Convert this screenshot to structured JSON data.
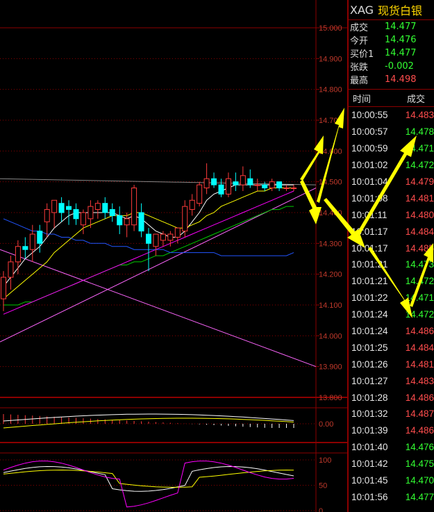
{
  "header": {
    "symbol": "XAG",
    "name": "现货白银"
  },
  "quote": [
    {
      "label": "成交",
      "value": "14.477",
      "color": "up"
    },
    {
      "label": "今开",
      "value": "14.476",
      "color": "up"
    },
    {
      "label": "买价1",
      "value": "14.477",
      "color": "up"
    },
    {
      "label": "张跌",
      "value": "-0.002",
      "color": "up"
    },
    {
      "label": "最高",
      "value": "14.498",
      "color": "dn"
    }
  ],
  "table": {
    "col_time": "时间",
    "col_price": "成交",
    "rows": [
      {
        "time": "10:00:55",
        "price": "14.483",
        "dir": "dn"
      },
      {
        "time": "10:00:57",
        "price": "14.478",
        "dir": "up"
      },
      {
        "time": "10:00:59",
        "price": "14.471",
        "dir": "up"
      },
      {
        "time": "10:01:02",
        "price": "14.472",
        "dir": "up"
      },
      {
        "time": "10:01:04",
        "price": "14.479",
        "dir": "dn"
      },
      {
        "time": "10:01:08",
        "price": "14.481",
        "dir": "dn"
      },
      {
        "time": "10:01:11",
        "price": "14.480",
        "dir": "dn"
      },
      {
        "time": "10:01:17",
        "price": "14.484",
        "dir": "dn"
      },
      {
        "time": "10:01:17",
        "price": "14.485",
        "dir": "dn"
      },
      {
        "time": "10:01:21",
        "price": "14.473",
        "dir": "up"
      },
      {
        "time": "10:01:21",
        "price": "14.472",
        "dir": "up"
      },
      {
        "time": "10:01:22",
        "price": "14.471",
        "dir": "up"
      },
      {
        "time": "10:01:24",
        "price": "14.472",
        "dir": "up"
      },
      {
        "time": "10:01:24",
        "price": "14.486",
        "dir": "dn"
      },
      {
        "time": "10:01:25",
        "price": "14.484",
        "dir": "dn"
      },
      {
        "time": "10:01:26",
        "price": "14.481",
        "dir": "dn"
      },
      {
        "time": "10:01:27",
        "price": "14.483",
        "dir": "dn"
      },
      {
        "time": "10:01:28",
        "price": "14.486",
        "dir": "dn"
      },
      {
        "time": "10:01:32",
        "price": "14.487",
        "dir": "dn"
      },
      {
        "time": "10:01:39",
        "price": "14.486",
        "dir": "dn"
      },
      {
        "time": "10:01:40",
        "price": "14.476",
        "dir": "up"
      },
      {
        "time": "10:01:42",
        "price": "14.475",
        "dir": "up"
      },
      {
        "time": "10:01:45",
        "price": "14.470",
        "dir": "up"
      },
      {
        "time": "10:01:56",
        "price": "14.477",
        "dir": "up"
      }
    ]
  },
  "chart_data": {
    "type": "candlestick",
    "title": "",
    "y_ticks": [
      "15.000",
      "14.900",
      "14.800",
      "14.700",
      "14.600",
      "14.500",
      "14.400",
      "14.300",
      "14.200",
      "14.100",
      "14.000",
      "13.900",
      "13.800"
    ],
    "ylim": [
      13.8,
      15.0
    ],
    "macd_ticks": [
      "0.00"
    ],
    "kdj_ticks": [
      "100",
      "50",
      "0"
    ],
    "colors": {
      "up": "#ff3b3b",
      "down": "#00ffff",
      "grid": "#8b0000",
      "arrow": "#ffff00"
    },
    "candles": [
      {
        "o": 14.12,
        "h": 14.21,
        "l": 14.08,
        "c": 14.19
      },
      {
        "o": 14.19,
        "h": 14.26,
        "l": 14.15,
        "c": 14.24
      },
      {
        "o": 14.24,
        "h": 14.31,
        "l": 14.2,
        "c": 14.29
      },
      {
        "o": 14.29,
        "h": 14.32,
        "l": 14.25,
        "c": 14.28
      },
      {
        "o": 14.28,
        "h": 14.36,
        "l": 14.24,
        "c": 14.33
      },
      {
        "o": 14.34,
        "h": 14.36,
        "l": 14.27,
        "c": 14.3
      },
      {
        "o": 14.37,
        "h": 14.43,
        "l": 14.32,
        "c": 14.41
      },
      {
        "o": 14.4,
        "h": 14.44,
        "l": 14.35,
        "c": 14.44
      },
      {
        "o": 14.43,
        "h": 14.45,
        "l": 14.37,
        "c": 14.4
      },
      {
        "o": 14.42,
        "h": 14.44,
        "l": 14.36,
        "c": 14.41
      },
      {
        "o": 14.41,
        "h": 14.43,
        "l": 14.36,
        "c": 14.38
      },
      {
        "o": 14.36,
        "h": 14.41,
        "l": 14.33,
        "c": 14.4
      },
      {
        "o": 14.38,
        "h": 14.44,
        "l": 14.35,
        "c": 14.42
      },
      {
        "o": 14.41,
        "h": 14.44,
        "l": 14.38,
        "c": 14.43
      },
      {
        "o": 14.43,
        "h": 14.45,
        "l": 14.38,
        "c": 14.4
      },
      {
        "o": 14.41,
        "h": 14.43,
        "l": 14.37,
        "c": 14.39
      },
      {
        "o": 14.39,
        "h": 14.42,
        "l": 14.33,
        "c": 14.36
      },
      {
        "o": 14.36,
        "h": 14.4,
        "l": 14.32,
        "c": 14.38
      },
      {
        "o": 14.36,
        "h": 14.49,
        "l": 14.34,
        "c": 14.48
      },
      {
        "o": 14.4,
        "h": 14.43,
        "l": 14.32,
        "c": 14.34
      },
      {
        "o": 14.33,
        "h": 14.35,
        "l": 14.21,
        "c": 14.3
      },
      {
        "o": 14.29,
        "h": 14.33,
        "l": 14.26,
        "c": 14.33
      },
      {
        "o": 14.31,
        "h": 14.34,
        "l": 14.29,
        "c": 14.33
      },
      {
        "o": 14.31,
        "h": 14.34,
        "l": 14.29,
        "c": 14.33
      },
      {
        "o": 14.32,
        "h": 14.35,
        "l": 14.3,
        "c": 14.35
      },
      {
        "o": 14.34,
        "h": 14.44,
        "l": 14.32,
        "c": 14.42
      },
      {
        "o": 14.41,
        "h": 14.46,
        "l": 14.39,
        "c": 14.44
      },
      {
        "o": 14.43,
        "h": 14.5,
        "l": 14.42,
        "c": 14.49
      },
      {
        "o": 14.48,
        "h": 14.56,
        "l": 14.46,
        "c": 14.51
      },
      {
        "o": 14.51,
        "h": 14.53,
        "l": 14.48,
        "c": 14.49
      },
      {
        "o": 14.49,
        "h": 14.51,
        "l": 14.45,
        "c": 14.46
      },
      {
        "o": 14.46,
        "h": 14.53,
        "l": 14.45,
        "c": 14.51
      },
      {
        "o": 14.5,
        "h": 14.53,
        "l": 14.47,
        "c": 14.49
      },
      {
        "o": 14.49,
        "h": 14.55,
        "l": 14.47,
        "c": 14.52
      },
      {
        "o": 14.51,
        "h": 14.54,
        "l": 14.48,
        "c": 14.49
      },
      {
        "o": 14.49,
        "h": 14.51,
        "l": 14.47,
        "c": 14.49
      },
      {
        "o": 14.49,
        "h": 14.5,
        "l": 14.47,
        "c": 14.48
      },
      {
        "o": 14.48,
        "h": 14.51,
        "l": 14.47,
        "c": 14.5
      },
      {
        "o": 14.5,
        "h": 14.5,
        "l": 14.47,
        "c": 14.48
      },
      {
        "o": 14.48,
        "h": 14.49,
        "l": 14.47,
        "c": 14.48
      },
      {
        "o": 14.48,
        "h": 14.49,
        "l": 14.47,
        "c": 14.48
      }
    ],
    "ma": [
      {
        "color": "#ffffff",
        "values": [
          14.16,
          14.19,
          14.22,
          14.25,
          14.27,
          14.29,
          14.32,
          14.35,
          14.37,
          14.39,
          14.4,
          14.4,
          14.4,
          14.4,
          14.4,
          14.4,
          14.39,
          14.38,
          14.39,
          14.38,
          14.36,
          14.34,
          14.33,
          14.32,
          14.32,
          14.34,
          14.37,
          14.4,
          14.44,
          14.46,
          14.47,
          14.48,
          14.49,
          14.49,
          14.49,
          14.49,
          14.49,
          14.49,
          14.49,
          14.49,
          14.49
        ]
      },
      {
        "color": "#ffff00",
        "values": [
          14.12,
          14.14,
          14.16,
          14.18,
          14.2,
          14.22,
          14.24,
          14.27,
          14.29,
          14.31,
          14.33,
          14.35,
          14.36,
          14.37,
          14.38,
          14.39,
          14.39,
          14.39,
          14.4,
          14.4,
          14.39,
          14.38,
          14.37,
          14.36,
          14.35,
          14.35,
          14.36,
          14.37,
          14.39,
          14.4,
          14.42,
          14.43,
          14.44,
          14.45,
          14.46,
          14.47,
          14.47,
          14.48,
          14.48,
          14.48,
          14.48
        ]
      },
      {
        "color": "#00cc00",
        "values": [
          14.1,
          14.1,
          14.1,
          14.11,
          14.11,
          14.12,
          14.13,
          14.14,
          14.15,
          14.16,
          14.17,
          14.18,
          14.19,
          14.2,
          14.21,
          14.22,
          14.23,
          14.23,
          14.24,
          14.24,
          14.25,
          14.26,
          14.26,
          14.27,
          14.28,
          14.29,
          14.3,
          14.31,
          14.32,
          14.33,
          14.34,
          14.35,
          14.36,
          14.37,
          14.38,
          14.39,
          14.4,
          14.41,
          14.41,
          14.42,
          14.42
        ]
      },
      {
        "color": "#ff00ff",
        "values": [
          14.07,
          14.08,
          14.09,
          14.1,
          14.11,
          14.12,
          14.13,
          14.14,
          14.15,
          14.16,
          14.17,
          14.18,
          14.19,
          14.2,
          14.21,
          14.22,
          14.23,
          14.24,
          14.25,
          14.26,
          14.27,
          14.28,
          14.29,
          14.3,
          14.31,
          14.32,
          14.33,
          14.34,
          14.35,
          14.36,
          14.37,
          14.38,
          14.39,
          14.4,
          14.41,
          14.42,
          14.43,
          14.44,
          14.45,
          14.46,
          14.47
        ]
      },
      {
        "color": "#2255ff",
        "values": [
          14.38,
          14.37,
          14.36,
          14.35,
          14.34,
          14.34,
          14.33,
          14.33,
          14.32,
          14.32,
          14.31,
          14.31,
          14.3,
          14.3,
          14.3,
          14.29,
          14.29,
          14.29,
          14.28,
          14.28,
          14.28,
          14.28,
          14.28,
          14.27,
          14.27,
          14.27,
          14.27,
          14.27,
          14.27,
          14.27,
          14.26,
          14.26,
          14.26,
          14.26,
          14.26,
          14.26,
          14.26,
          14.26,
          14.26,
          14.26,
          14.27
        ]
      }
    ],
    "trendlines": [
      {
        "color": "#ff66ff",
        "from": [
          0,
          14.28
        ],
        "to": [
          1,
          13.9
        ]
      },
      {
        "color": "#ff66ff",
        "from": [
          0,
          13.98
        ],
        "to": [
          1,
          14.48
        ]
      },
      {
        "color": "#888888",
        "from": [
          0,
          14.51
        ],
        "to": [
          1,
          14.49
        ]
      }
    ]
  }
}
